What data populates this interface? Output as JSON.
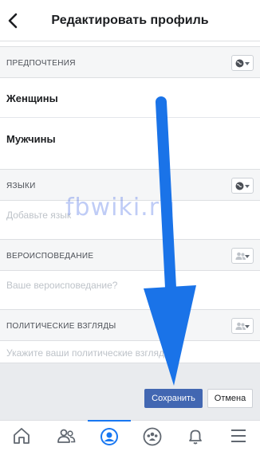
{
  "header": {
    "title": "Редактировать профиль"
  },
  "sections": {
    "preferences": {
      "label": "ПРЕДПОЧТЕНИЯ",
      "options": [
        "Женщины",
        "Мужчины"
      ]
    },
    "languages": {
      "label": "ЯЗЫКИ",
      "placeholder": "Добавьте язык"
    },
    "religion": {
      "label": "ВЕРОИСПОВЕДАНИЕ",
      "placeholder": "Ваше вероисповедание?"
    },
    "politics": {
      "label": "ПОЛИТИЧЕСКИЕ ВЗГЛЯДЫ",
      "placeholder": "Укажите ваши политические взгляды"
    }
  },
  "buttons": {
    "save": "Сохранить",
    "cancel": "Отмена"
  },
  "watermark": "fbwiki.ru",
  "tabbar": {
    "items": [
      {
        "icon": "home-icon",
        "active": false
      },
      {
        "icon": "friends-icon",
        "active": false
      },
      {
        "icon": "profile-icon",
        "active": true
      },
      {
        "icon": "groups-icon",
        "active": false
      },
      {
        "icon": "bell-icon",
        "active": false
      },
      {
        "icon": "menu-icon",
        "active": false
      }
    ]
  },
  "colors": {
    "accent": "#1877f2",
    "button": "#4267b2",
    "arrow": "#1a73e8"
  }
}
